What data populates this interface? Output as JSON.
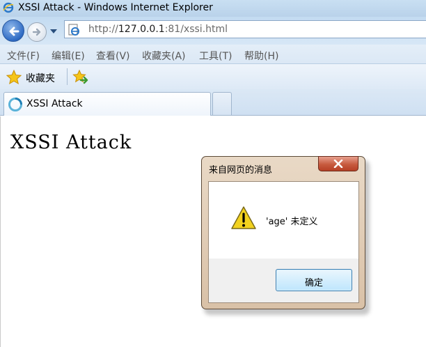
{
  "window": {
    "title": "XSSI Attack - Windows Internet Explorer",
    "icon": "ie-icon"
  },
  "navbar": {
    "back_icon": "back-arrow-icon",
    "forward_icon": "forward-arrow-icon",
    "url_prefix": "http://",
    "url_host": "127.0.0.1",
    "url_rest": ":81/xssi.html"
  },
  "menubar": {
    "items": [
      "文件(F)",
      "编辑(E)",
      "查看(V)",
      "收藏夹(A)",
      "工具(T)",
      "帮助(H)"
    ]
  },
  "favorites": {
    "label": "收藏夹"
  },
  "tabs": [
    {
      "label": "XSSI Attack"
    }
  ],
  "page": {
    "heading": "XSSI Attack"
  },
  "dialog": {
    "title": "来自网页的消息",
    "message": "'age' 未定义",
    "ok_label": "确定",
    "icon": "warning-icon"
  },
  "colors": {
    "chrome_blue": "#c9dff2",
    "dialog_frame": "#e0ccb5",
    "close_red": "#c75a3e"
  }
}
